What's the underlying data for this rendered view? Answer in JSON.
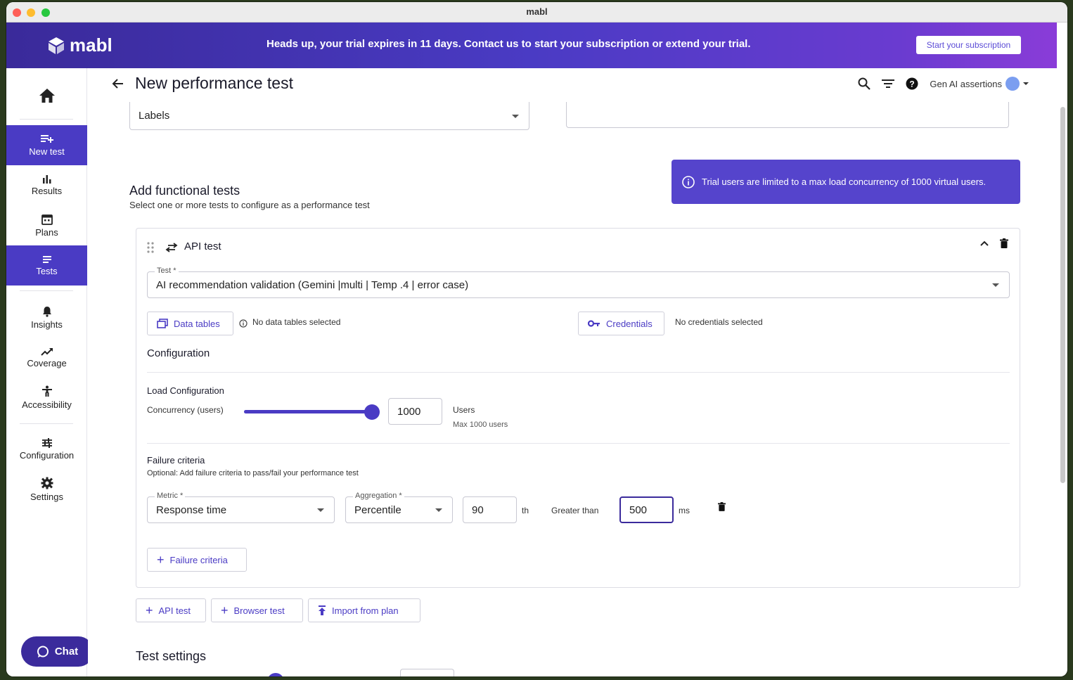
{
  "window": {
    "title": "mabl"
  },
  "banner": {
    "logo_text": "mabl",
    "message": "Heads up, your trial expires in 11 days. Contact us to start your subscription or extend your trial.",
    "cta": "Start your subscription"
  },
  "sidebar": {
    "items": [
      {
        "label": "New test",
        "icon": "playlist-add-icon",
        "active": true
      },
      {
        "label": "Results",
        "icon": "bar-chart-icon",
        "active": false
      },
      {
        "label": "Plans",
        "icon": "calendar-icon",
        "active": false
      },
      {
        "label": "Tests",
        "icon": "list-icon",
        "active": true
      },
      {
        "label": "Insights",
        "icon": "bell-icon",
        "active": false
      },
      {
        "label": "Coverage",
        "icon": "trend-icon",
        "active": false
      },
      {
        "label": "Accessibility",
        "icon": "accessibility-icon",
        "active": false
      },
      {
        "label": "Configuration",
        "icon": "sliders-icon",
        "active": false
      },
      {
        "label": "Settings",
        "icon": "gear-icon",
        "active": false
      }
    ],
    "chat_label": "Chat"
  },
  "header": {
    "title": "New performance test",
    "workspace": "Gen AI assertions"
  },
  "form": {
    "labels_value": "Labels",
    "section_title": "Add functional tests",
    "section_subtitle": "Select one or more tests to configure as a performance test",
    "trial_notice": "Trial users are limited to a max load concurrency of 1000 virtual users.",
    "card": {
      "type_label": "API test",
      "test_field_label": "Test *",
      "test_value": "AI recommendation validation (Gemini |multi | Temp .4 | error case)",
      "data_tables_btn": "Data tables",
      "data_tables_status": "No data tables selected",
      "credentials_btn": "Credentials",
      "credentials_status": "No credentials selected",
      "configuration_title": "Configuration",
      "load_title": "Load Configuration",
      "concurrency_label": "Concurrency (users)",
      "concurrency_value": "1000",
      "concurrency_fraction": 1.0,
      "users_label": "Users",
      "max_users": "Max 1000 users",
      "failure_title": "Failure criteria",
      "failure_subtitle": "Optional: Add failure criteria to pass/fail your performance test",
      "metric_label": "Metric *",
      "metric_value": "Response time",
      "aggregation_label": "Aggregation *",
      "aggregation_value": "Percentile",
      "percentile_value": "90",
      "percentile_suffix": "th",
      "comparator": "Greater than",
      "threshold_value": "500",
      "threshold_unit": "ms",
      "add_failure_btn": "Failure criteria"
    },
    "add_api_btn": "API test",
    "add_browser_btn": "Browser test",
    "import_btn": "Import from plan",
    "test_settings_title": "Test settings"
  },
  "colors": {
    "accent": "#4a3bc4",
    "banner_start": "#3a2a9a",
    "banner_end": "#8a3cd8"
  }
}
